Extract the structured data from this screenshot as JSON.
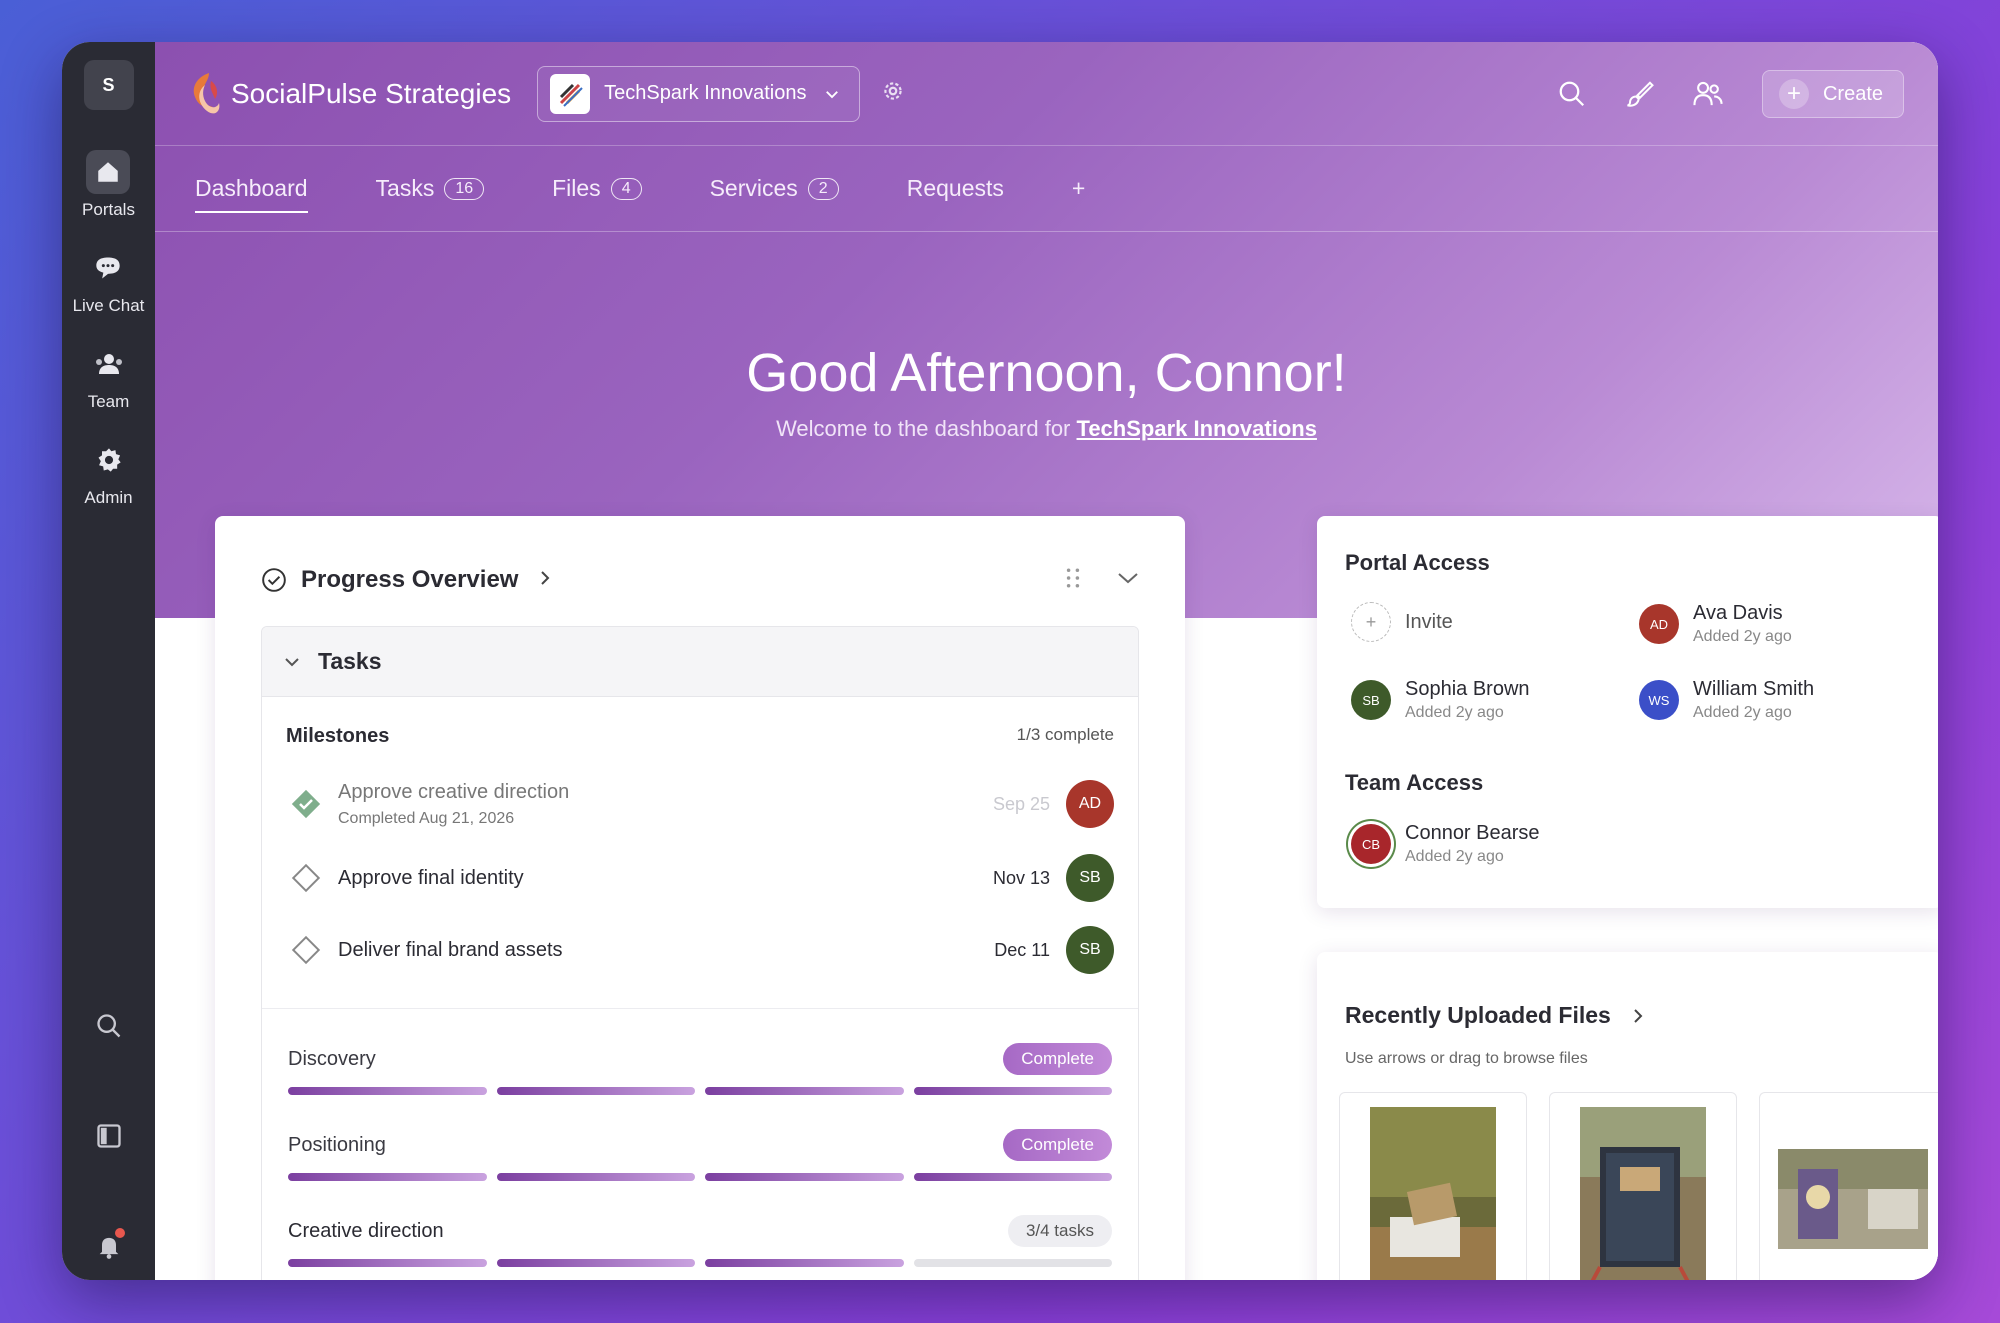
{
  "sidebar": {
    "workspace_initial": "S",
    "items": [
      {
        "label": "Portals",
        "icon": "home-icon"
      },
      {
        "label": "Live Chat",
        "icon": "chat-icon"
      },
      {
        "label": "Team",
        "icon": "team-icon"
      },
      {
        "label": "Admin",
        "icon": "gear-icon"
      }
    ],
    "bottom_icons": [
      "search-icon",
      "panel-toggle-icon",
      "bell-icon"
    ]
  },
  "header": {
    "brand_name": "SocialPulse Strategies",
    "client_select": "TechSpark Innovations",
    "create_label": "Create"
  },
  "tabs": [
    {
      "label": "Dashboard",
      "count": null,
      "active": true
    },
    {
      "label": "Tasks",
      "count": "16"
    },
    {
      "label": "Files",
      "count": "4"
    },
    {
      "label": "Services",
      "count": "2"
    },
    {
      "label": "Requests",
      "count": null
    },
    {
      "label": "+",
      "count": null
    }
  ],
  "hero": {
    "greeting": "Good Afternoon, Connor!",
    "welcome_prefix": "Welcome to the dashboard for",
    "welcome_link": "TechSpark Innovations"
  },
  "progress": {
    "title": "Progress Overview",
    "tasks_title": "Tasks",
    "milestones_title": "Milestones",
    "milestones_count": "1/3 complete",
    "milestones": [
      {
        "name": "Approve creative direction",
        "sub": "Completed Aug 21, 2026",
        "date": "Sep 25",
        "assignee": "AD",
        "color": "#a8362b",
        "done": true
      },
      {
        "name": "Approve final identity",
        "sub": "",
        "date": "Nov 13",
        "assignee": "SB",
        "color": "#3e5a2a",
        "done": false
      },
      {
        "name": "Deliver final brand assets",
        "sub": "",
        "date": "Dec 11",
        "assignee": "SB",
        "color": "#3e5a2a",
        "done": false
      }
    ],
    "phases": [
      {
        "name": "Discovery",
        "badge": "Complete",
        "progress": 1.0
      },
      {
        "name": "Positioning",
        "badge": "Complete",
        "progress": 1.0
      },
      {
        "name": "Creative direction",
        "badge": "3/4 tasks",
        "progress": 0.75
      }
    ]
  },
  "portal_access": {
    "title": "Portal Access",
    "invite_label": "Invite",
    "members": [
      {
        "initials": "AD",
        "name": "Ava Davis",
        "added": "Added 2y ago",
        "color": "#a8362b"
      },
      {
        "initials": "SB",
        "name": "Sophia Brown",
        "added": "Added 2y ago",
        "color": "#3e5a2a"
      },
      {
        "initials": "WS",
        "name": "William Smith",
        "added": "Added 2y ago",
        "color": "#3b4fc8"
      }
    ],
    "team_title": "Team Access",
    "team": [
      {
        "initials": "CB",
        "name": "Connor Bearse",
        "added": "Added 2y ago",
        "color": "#a8262b"
      }
    ]
  },
  "files": {
    "title": "Recently Uploaded Files",
    "subtitle": "Use arrows or drag to browse files"
  },
  "colors": {
    "sidebar_bg": "#2a2b34",
    "hero_start": "#8c50b0",
    "hero_end": "#d7b7ea",
    "accent": "#a669c5"
  }
}
